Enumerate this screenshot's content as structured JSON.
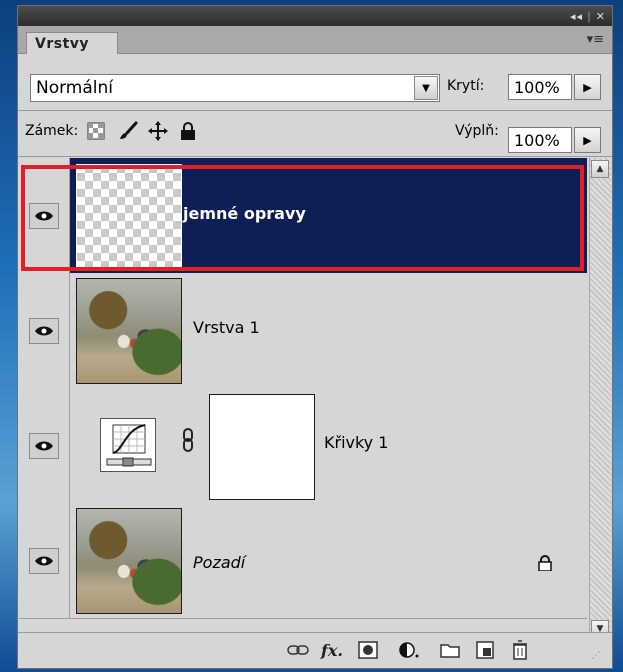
{
  "panel": {
    "tab_label": "Vrstvy",
    "collapse_glyph": "◂◂",
    "close_glyph": "✕",
    "menu_glyph": "▾≡"
  },
  "controls": {
    "blend_mode": "Normální",
    "opacity_label": "Krytí:",
    "opacity_value": "100%",
    "lock_label": "Zámek:",
    "fill_label": "Výplň:",
    "fill_value": "100%"
  },
  "layers": [
    {
      "name": "jemné opravy",
      "selected": true,
      "italic": false,
      "thumbnail": "transparent"
    },
    {
      "name": "Vrstva 1",
      "selected": false,
      "italic": false,
      "thumbnail": "photo"
    },
    {
      "name": "Křivky 1",
      "selected": false,
      "italic": false,
      "thumbnail": "curves-adjustment"
    },
    {
      "name": "Pozadí",
      "selected": false,
      "italic": true,
      "thumbnail": "photo",
      "locked": true
    }
  ],
  "colors": {
    "selected_row": "#0d1f55",
    "highlight_border": "#e51e25",
    "panel_bg": "#d6d6d6"
  },
  "footer_icons": [
    "link-layers-icon",
    "fx-icon",
    "add-mask-icon",
    "adjustment-layer-icon",
    "group-folder-icon",
    "new-layer-icon",
    "trash-icon"
  ]
}
